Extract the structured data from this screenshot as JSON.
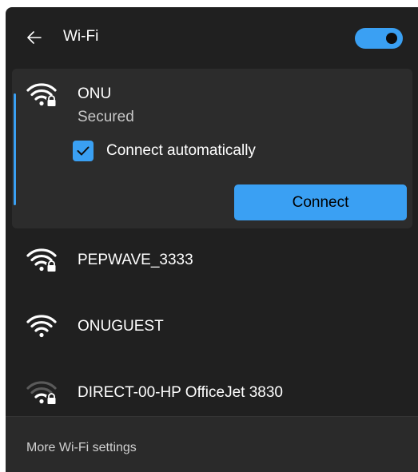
{
  "header": {
    "back_icon": "back-arrow-icon",
    "title": "Wi-Fi",
    "toggle_state": "on"
  },
  "networks": [
    {
      "name": "ONU",
      "status": "Secured",
      "secured": true,
      "connect_automatically_label": "Connect automatically",
      "connect_automatically_checked": true,
      "connect_label": "Connect"
    },
    {
      "name": "PEPWAVE_3333",
      "secured": true
    },
    {
      "name": "ONUGUEST",
      "secured": false
    },
    {
      "name": "DIRECT-00-HP OfficeJet 3830",
      "secured": true,
      "weak_signal": true
    }
  ],
  "footer": {
    "link_label": "More Wi-Fi settings"
  },
  "colors": {
    "accent": "#3aa0f3",
    "panel_bg": "#202020",
    "selected_bg": "#2c2c2c",
    "footer_bg": "#2a2a2a"
  }
}
